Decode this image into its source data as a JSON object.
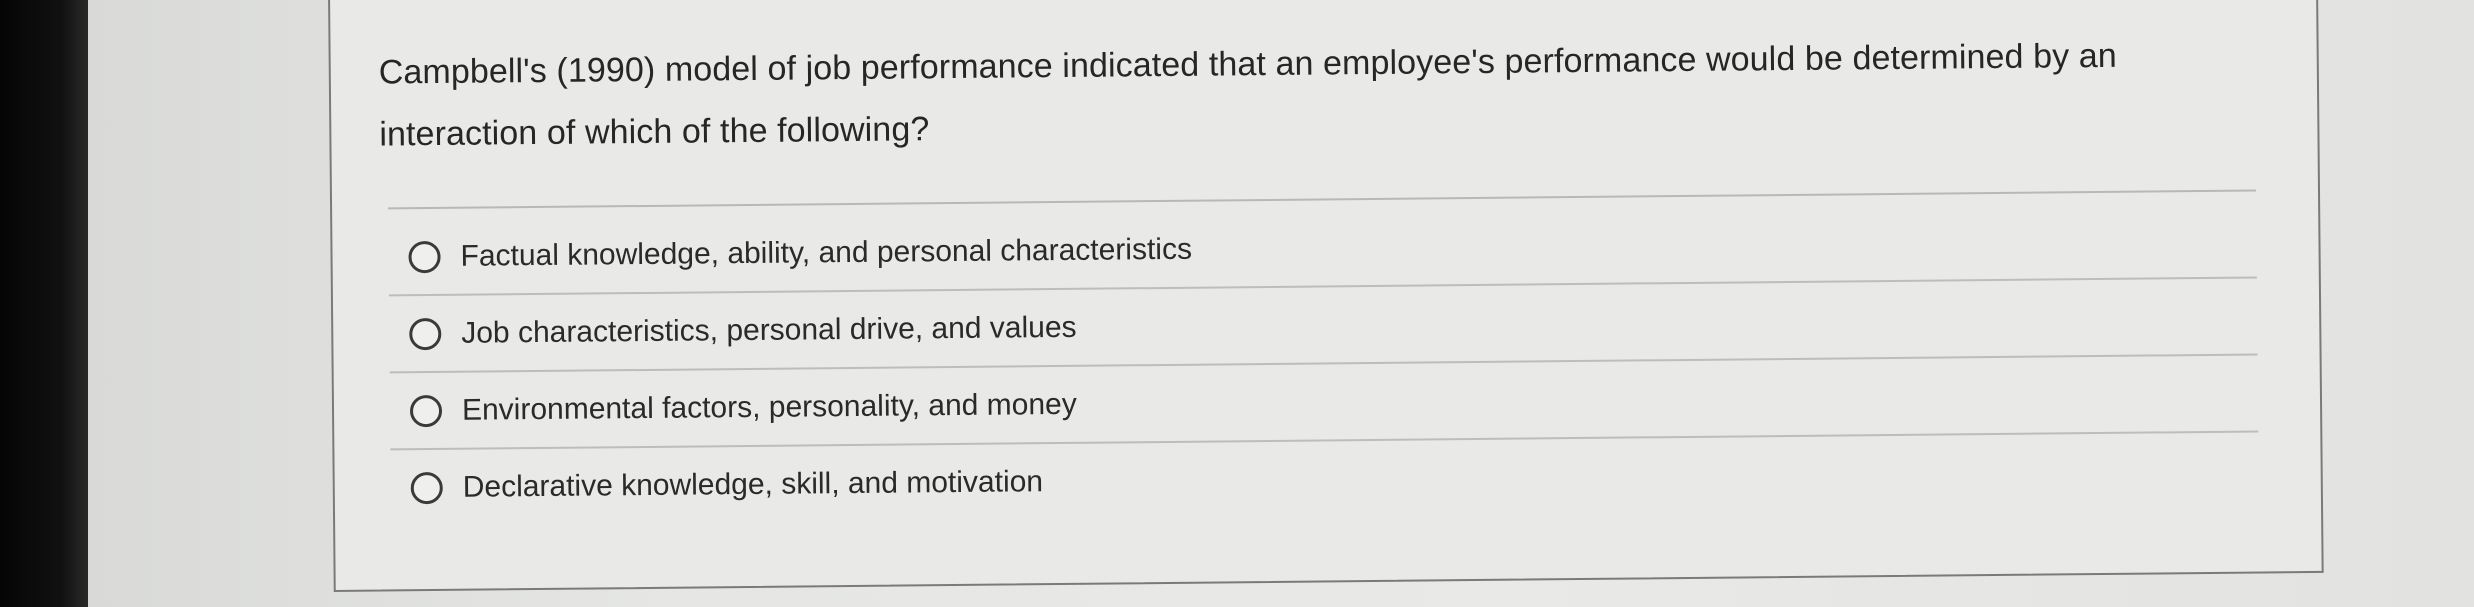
{
  "question": {
    "text_line1": "Campbell's (1990) model of job performance indicated that an employee's performance would be determined by an",
    "text_line2": "interaction of which of the following?"
  },
  "options": [
    {
      "label": "Factual knowledge, ability, and personal characteristics",
      "selected": false
    },
    {
      "label": "Job characteristics, personal drive, and values",
      "selected": false
    },
    {
      "label": "Environmental factors, personality, and money",
      "selected": false
    },
    {
      "label": "Declarative knowledge, skill, and motivation",
      "selected": false
    }
  ],
  "colors": {
    "page_background": "#e8e8e6",
    "text": "#262626",
    "card_border": "#7a7a78",
    "rule": "#bdbdbb"
  }
}
